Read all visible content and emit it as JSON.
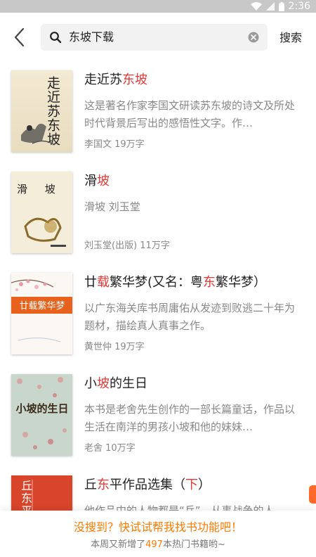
{
  "status_bar": {
    "time": "2:36"
  },
  "search": {
    "query": "东坡下载",
    "submit_label": "搜索"
  },
  "results": [
    {
      "title_parts": [
        "走近苏",
        "东坡"
      ],
      "description": "这是著名作家李国文研读苏东坡的诗文及所处时代背景后写出的感悟性文字。作…",
      "meta": "李国文  19万字",
      "cover_text": "走近苏东坡"
    },
    {
      "title_parts": [
        "滑",
        "坡"
      ],
      "description": "滑坡 刘玉堂",
      "meta": "刘玉堂(出版)  11万字",
      "cover_text": "滑 坡"
    },
    {
      "title_parts": [
        "廿",
        "载",
        "繁华梦(又名：粤",
        "东",
        "繁华梦）"
      ],
      "description": "以广东海关库书周庸佑从发迹到败逃二十年为题材，描绘真人真事之作。",
      "meta": "黄世仲  19万字",
      "cover_text": "廿载繁华梦"
    },
    {
      "title_parts": [
        "小",
        "坡",
        "的生日"
      ],
      "description": "本书是老舍先生创作的一部长篇童话，作品以生活在南洋的男孩小坡和他的妹妹…",
      "meta": "老舍  10万字",
      "cover_text": "小坡的生日"
    },
    {
      "title_parts": [
        "丘",
        "东",
        "平作品选集（",
        "下",
        "）"
      ],
      "description": "他作品中的人物都是“兵”，从事战争的人…",
      "meta": "",
      "cover_text": "丘东平选集"
    }
  ],
  "banner": {
    "main": "没搜到？快试试帮我找书功能吧！",
    "sub_prefix": "本周又新增了",
    "sub_count": "497",
    "sub_suffix": "本热门书籍哟~"
  },
  "colors": {
    "highlight": "#e53935",
    "accent": "#ff7a00"
  }
}
